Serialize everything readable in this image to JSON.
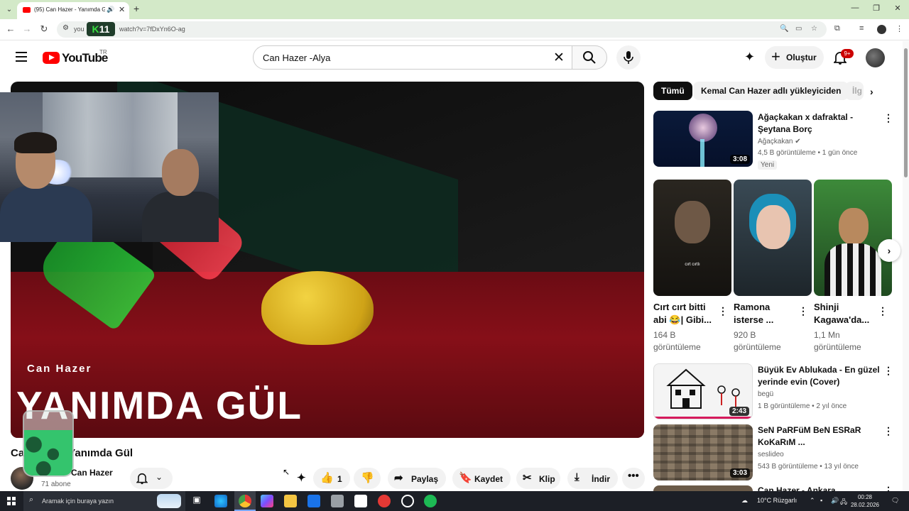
{
  "browser": {
    "tab_title": "(95) Can Hazer - Yanımda Gül",
    "url_prefix": "you",
    "url_rest": "watch?v=7fDxYn6O-ag",
    "overlay_badge": "11"
  },
  "header": {
    "logo_text": "YouTube",
    "logo_country": "TR",
    "search_query": "Can Hazer -Alya",
    "create_label": "Oluştur",
    "notif_count": "9+"
  },
  "player": {
    "overlay_artist": "Can Hazer",
    "overlay_title": "YANIMDA GÜL"
  },
  "video": {
    "title_start": "Ca",
    "title_end": "Yanımda Gül",
    "channel_name": "Can Hazer",
    "subscribers": "71 abone",
    "like_count": "1",
    "share_label": "Paylaş",
    "save_label": "Kaydet",
    "clip_label": "Klip",
    "download_label": "İndir"
  },
  "sidebar": {
    "chips": [
      "Tümü",
      "Kemal Can Hazer adlı yükleyiciden",
      "İlg"
    ],
    "videos": [
      {
        "title_l1": "Ağaçkakan x dafraktal -",
        "title_l2": "Şeytana Borç",
        "channel": "Ağaçkakan",
        "meta": "4,5 B görüntüleme • 1 gün önce",
        "badge": "Yeni",
        "duration": "3:08"
      },
      {
        "title_l1": "Büyük Ev Ablukada - En güzel",
        "title_l2": "yerinde evin (Cover)",
        "channel": "begü",
        "meta": "1 B görüntüleme • 2 yıl önce",
        "badge": "",
        "duration": "2:43"
      },
      {
        "title_l1": "SeN PaRFüM BeN ESRaR",
        "title_l2": "KoKaRıM ...",
        "channel": "seslideo",
        "meta": "543 B görüntüleme • 13 yıl önce",
        "badge": "",
        "duration": "3:03"
      },
      {
        "title_l1": "Can Hazer - Ankara",
        "title_l2": "",
        "channel": "",
        "meta": "",
        "badge": "",
        "duration": ""
      }
    ],
    "shorts": [
      {
        "title_l1": "Cırt cırt bitti",
        "title_l2": "abi 😂| Gibi...",
        "views_l1": "164 B",
        "views_l2": "görüntüleme",
        "caption": "cırt cırtlı"
      },
      {
        "title_l1": "Ramona",
        "title_l2": "isterse ...",
        "views_l1": "920 B",
        "views_l2": "görüntüleme",
        "caption": ""
      },
      {
        "title_l1": "Shinji",
        "title_l2": "Kagawa'da...",
        "views_l1": "1,1 Mn",
        "views_l2": "görüntüleme",
        "caption": ""
      }
    ]
  },
  "taskbar": {
    "search_placeholder": "Aramak için buraya yazın",
    "weather": "10°C Rüzgarlı",
    "time": "00:28",
    "date": "28.02.2026"
  }
}
